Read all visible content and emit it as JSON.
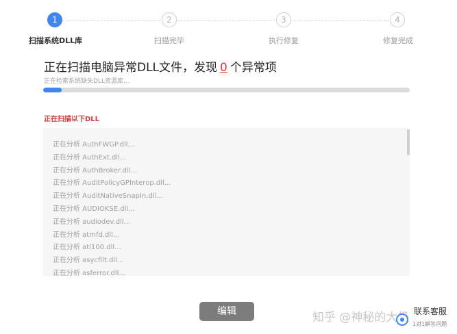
{
  "steps": [
    {
      "number": "1",
      "label": "扫描系统DLL库",
      "active": true
    },
    {
      "number": "2",
      "label": "扫描完毕",
      "active": false
    },
    {
      "number": "3",
      "label": "执行修复",
      "active": false
    },
    {
      "number": "4",
      "label": "修复完成",
      "active": false
    }
  ],
  "scan": {
    "title_prefix": "正在扫描电脑异常DLL文件，发现",
    "found_count": "0",
    "title_suffix": "个异常项",
    "subtitle": "正在检索系统缺失DLL资源库...",
    "progress": 0.05
  },
  "section_title": "正在扫描以下DLL",
  "dll_list": [
    "正在分析 AuthFWGP.dll...",
    "正在分析 AuthExt.dll...",
    "正在分析 AuthBroker.dll...",
    "正在分析 AuditPolicyGPInterop.dll...",
    "正在分析 AuditNativeSnapIn.dll...",
    "正在分析 AUDIOKSE.dll...",
    "正在分析 audiodev.dll...",
    "正在分析 atmfd.dll...",
    "正在分析 atl100.dll...",
    "正在分析 asycfilt.dll...",
    "正在分析 asferror.dll..."
  ],
  "edit_button": "编辑",
  "watermark": "知乎 @神秘的大极",
  "service": {
    "title": "联系客服",
    "subtitle": "1对1解答问题"
  },
  "colors": {
    "accent": "#3f86ee",
    "alert": "#e03a3a",
    "button": "#7c7c7c"
  }
}
